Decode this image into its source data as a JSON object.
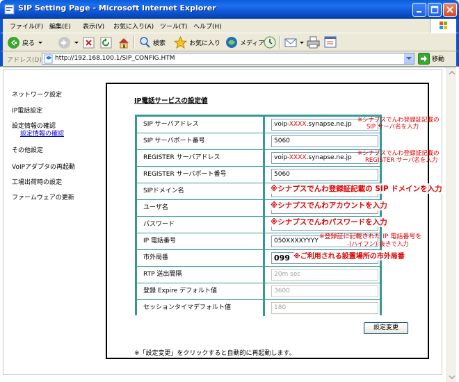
{
  "window": {
    "title": "SIP Setting Page - Microsoft Internet Explorer"
  },
  "menu": [
    "ファイル(F)",
    "編集(E)",
    "表示(V)",
    "お気に入り(A)",
    "ツール(T)",
    "ヘルプ(H)"
  ],
  "toolbar": {
    "back": "戻る",
    "search": "検索",
    "favorites": "お気に入り",
    "media": "メディア"
  },
  "address": {
    "label": "アドレス(D)",
    "url": "http://192.168.100.1/SIP_CONFIG.HTM",
    "go": "移動"
  },
  "sidebar": {
    "items": [
      "ネットワーク設定",
      "IP電話設定",
      "設定情報の確認",
      "その他設定",
      "VoIPアダプタの再起動",
      "工場出荷時の設定",
      "ファームウェアの更新"
    ],
    "sub_item": "設定情報の確認"
  },
  "panel": {
    "title": "IP電話サービスの設定値",
    "rows": [
      {
        "label": "SIP サーバアドレス",
        "value_pre": "voip-",
        "value_red": "XXXX",
        "value_post": ".synapse.ne.jp"
      },
      {
        "label": "SIP サーバポート番号",
        "value": "5060"
      },
      {
        "label": "REGISTER サーバアドレス",
        "value_pre": "voip-",
        "value_red": "XXXX",
        "value_post": ".synapse.ne.jp"
      },
      {
        "label": "REGISTER サーバポート番号",
        "value": "5060"
      },
      {
        "label": "SIPドメイン名",
        "value": ""
      },
      {
        "label": "ユーザ名",
        "value": ""
      },
      {
        "label": "パスワード",
        "value": ""
      },
      {
        "label": "IP 電話番号",
        "value": "050XXXXYYYY"
      },
      {
        "label": "市外局番",
        "value": "099"
      },
      {
        "label": "RTP 送出間隔",
        "value": "20m sec"
      },
      {
        "label": "登録 Expire デフォルト値",
        "value": "3600"
      },
      {
        "label": "セッションタイマデフォルト値",
        "value": "180"
      }
    ],
    "notes": {
      "sip_server_1": "※シナプスでんわ登録証記載の",
      "sip_server_2": "SIP サーバ名を入力",
      "register_server_1": "※シナプスでんわ登録証記載の",
      "register_server_2": "REGISTER サーバ名を入力",
      "sip_domain": "※シナプスでんわ登録証記載の SIP ドメインを入力",
      "username": "※シナプスでんわアカウントを入力",
      "password": "※シナプスでんわパスワードを入力",
      "phone_1": "※登録証に記載された IP 電話番号を",
      "phone_2": "-(ハイフン) 抜きで入力",
      "area_code": "※ご利用される設置場所の市外局番"
    },
    "submit_label": "設定変更",
    "footer": "※「設定変更」をクリックすると自動的に再起動します。"
  }
}
